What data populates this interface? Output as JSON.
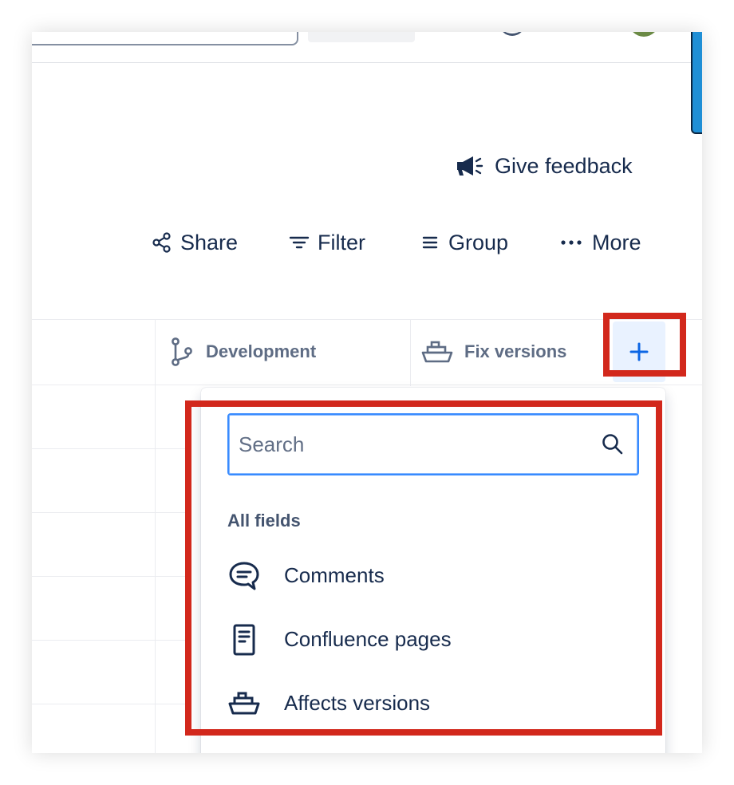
{
  "header": {
    "feedback_label": "Give feedback",
    "feedback_icon": "megaphone-icon"
  },
  "toolbar": {
    "share_label": "Share",
    "filter_label": "Filter",
    "group_label": "Group",
    "more_label": "More"
  },
  "table": {
    "columns": [
      {
        "label": "Development",
        "icon": "branch-icon"
      },
      {
        "label": "Fix versions",
        "icon": "ship-icon"
      }
    ],
    "add_column_icon": "plus-icon"
  },
  "dropdown": {
    "search_placeholder": "Search",
    "search_value": "",
    "section_title": "All fields",
    "items": [
      {
        "label": "Comments",
        "icon": "comment-icon"
      },
      {
        "label": "Confluence pages",
        "icon": "page-icon"
      },
      {
        "label": "Affects versions",
        "icon": "ship-icon"
      }
    ]
  },
  "colors": {
    "text": "#172b4d",
    "subtle_text": "#5e6c84",
    "accent": "#0c66e4",
    "focus_border": "#388bff",
    "highlight": "#d2281c"
  }
}
